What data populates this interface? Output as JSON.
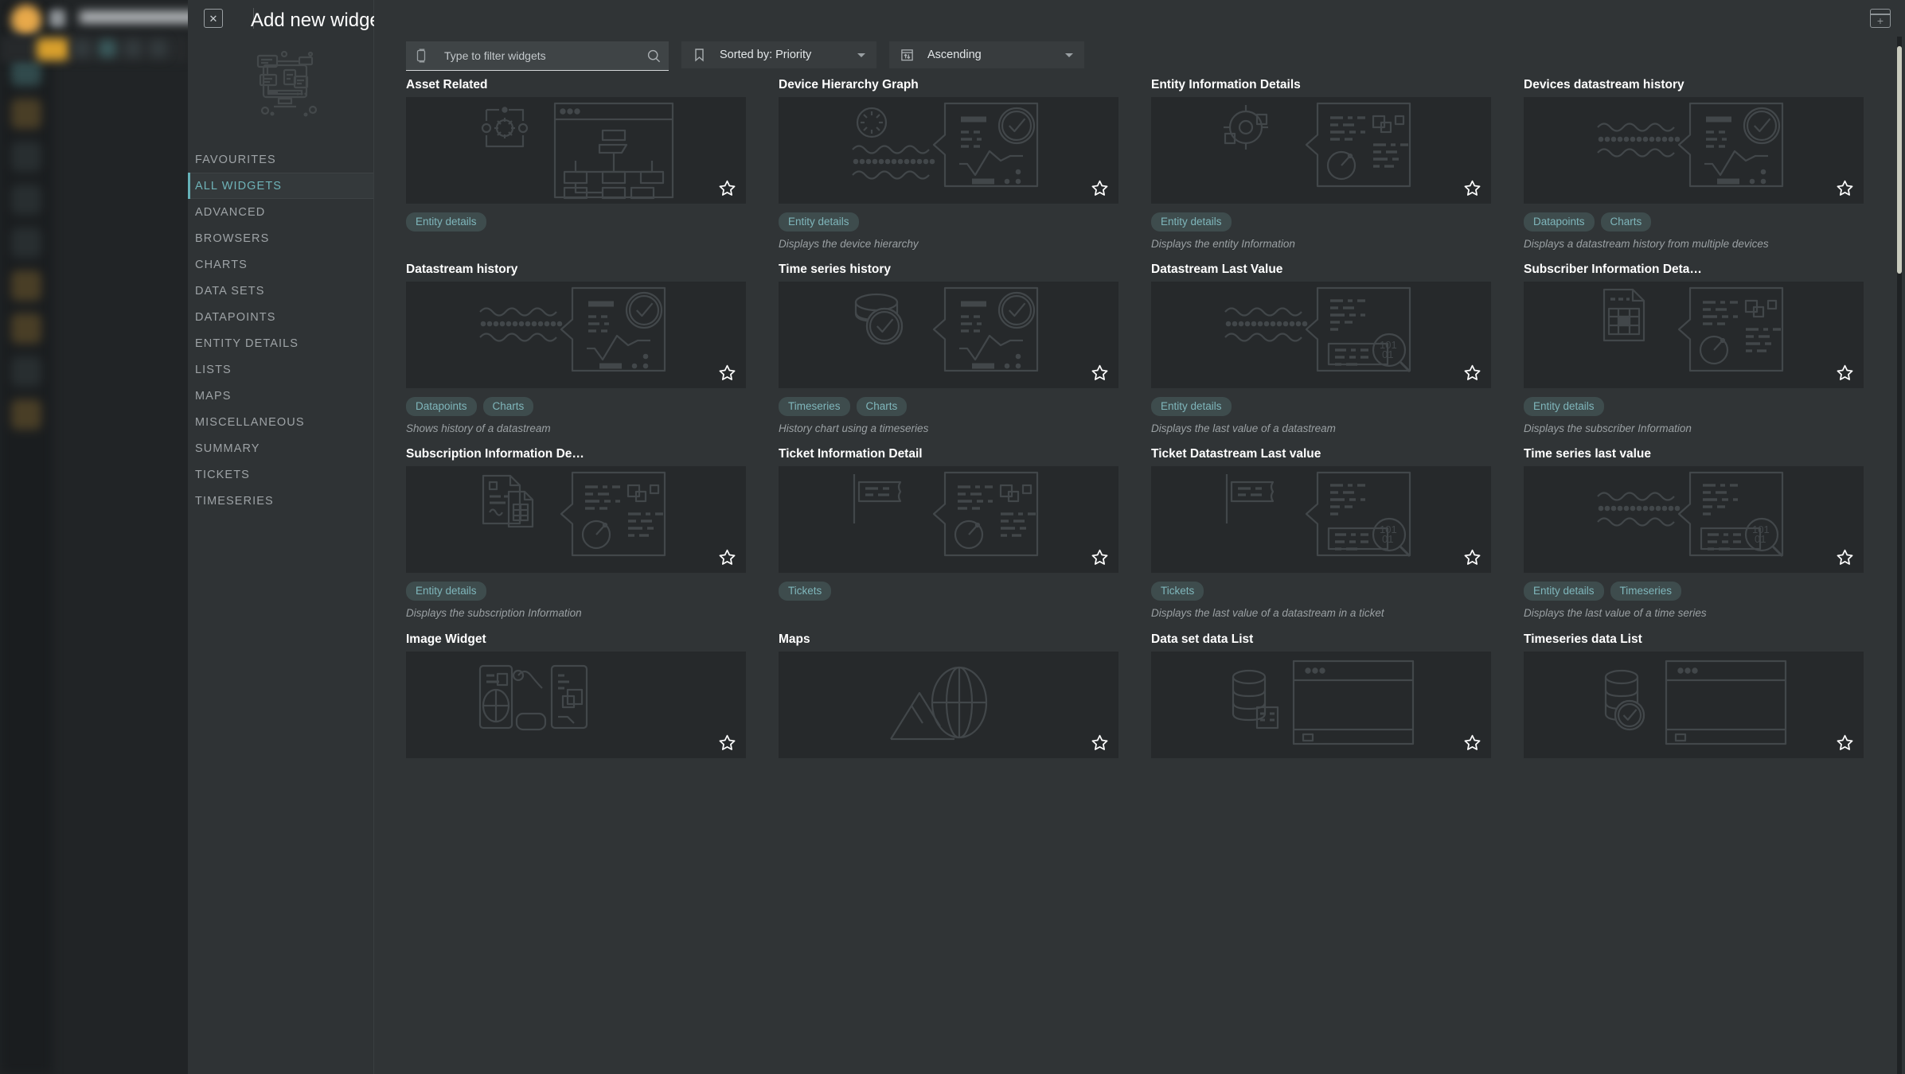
{
  "modal": {
    "title": "Add new widget",
    "close_label": "✕",
    "illustration_icon": "dashboard-widgets-illustration"
  },
  "sidebar": {
    "items": [
      {
        "label": "FAVOURITES",
        "active": false
      },
      {
        "label": "ALL WIDGETS",
        "active": true
      },
      {
        "label": "ADVANCED",
        "active": false
      },
      {
        "label": "BROWSERS",
        "active": false
      },
      {
        "label": "CHARTS",
        "active": false
      },
      {
        "label": "DATA SETS",
        "active": false
      },
      {
        "label": "DATAPOINTS",
        "active": false
      },
      {
        "label": "ENTITY DETAILS",
        "active": false
      },
      {
        "label": "LISTS",
        "active": false
      },
      {
        "label": "MAPS",
        "active": false
      },
      {
        "label": "MISCELLANEOUS",
        "active": false
      },
      {
        "label": "SUMMARY",
        "active": false
      },
      {
        "label": "TICKETS",
        "active": false
      },
      {
        "label": "TIMESERIES",
        "active": false
      }
    ]
  },
  "toolbar": {
    "add_widget_icon": "add-widget-icon",
    "add_widget_glyph": "+",
    "search": {
      "value": "",
      "placeholder": "Type to filter widgets",
      "left_icon": "widget-icon",
      "right_icon": "search-icon"
    },
    "sort": {
      "label": "Sorted by: Priority",
      "icon": "bookmark-icon"
    },
    "direction": {
      "label": "Ascending",
      "icon": "sort-ascending-icon"
    }
  },
  "colors": {
    "accent_teal": "#66b2b8",
    "tag_bg": "#3e4c4d",
    "tag_text": "#7fb6bb",
    "modal_bg": "#303436",
    "preview_bg": "#26292b"
  },
  "widgets": [
    {
      "title": "Asset Related",
      "icon": "asset-gear-hierarchy-icon",
      "tags": [
        "Entity details"
      ],
      "desc": ""
    },
    {
      "title": "Device Hierarchy Graph",
      "icon": "device-hierarchy-icon",
      "tags": [
        "Entity details"
      ],
      "desc": "Displays the device hierarchy"
    },
    {
      "title": "Entity Information Details",
      "icon": "entity-information-icon",
      "tags": [
        "Entity details"
      ],
      "desc": "Displays the entity Information"
    },
    {
      "title": "Devices datastream history",
      "icon": "datastream-history-icon",
      "tags": [
        "Datapoints",
        "Charts"
      ],
      "desc": "Displays a datastream history from multiple devices"
    },
    {
      "title": "Datastream history",
      "icon": "datastream-history-icon",
      "tags": [
        "Datapoints",
        "Charts"
      ],
      "desc": "Shows history of a datastream"
    },
    {
      "title": "Time series history",
      "icon": "timeseries-history-icon",
      "tags": [
        "Timeseries",
        "Charts"
      ],
      "desc": "History chart using a timeseries"
    },
    {
      "title": "Datastream Last Value",
      "icon": "datastream-last-value-icon",
      "tags": [
        "Entity details"
      ],
      "desc": "Displays the last value of a datastream"
    },
    {
      "title": "Subscriber Information Deta…",
      "icon": "subscriber-information-icon",
      "tags": [
        "Entity details"
      ],
      "desc": "Displays the subscriber Information"
    },
    {
      "title": "Subscription Information De…",
      "icon": "subscription-information-icon",
      "tags": [
        "Entity details"
      ],
      "desc": "Displays the subscription Information"
    },
    {
      "title": "Ticket Information Detail",
      "icon": "ticket-information-icon",
      "tags": [
        "Tickets"
      ],
      "desc": ""
    },
    {
      "title": "Ticket Datastream Last value",
      "icon": "ticket-datastream-icon",
      "tags": [
        "Tickets"
      ],
      "desc": "Displays the last value of a datastream in a ticket"
    },
    {
      "title": "Time series last value",
      "icon": "timeseries-last-value-icon",
      "tags": [
        "Entity details",
        "Timeseries"
      ],
      "desc": "Displays the last value of a time series"
    },
    {
      "title": "Image Widget",
      "icon": "image-widget-icon",
      "tags": [],
      "desc": ""
    },
    {
      "title": "Maps",
      "icon": "maps-icon",
      "tags": [],
      "desc": ""
    },
    {
      "title": "Data set data List",
      "icon": "dataset-list-icon",
      "tags": [],
      "desc": ""
    },
    {
      "title": "Timeseries data List",
      "icon": "timeseries-list-icon",
      "tags": [],
      "desc": ""
    }
  ],
  "favorite_icon": "star-outline-icon",
  "scrollbar": {
    "name": "vertical-scrollbar"
  }
}
